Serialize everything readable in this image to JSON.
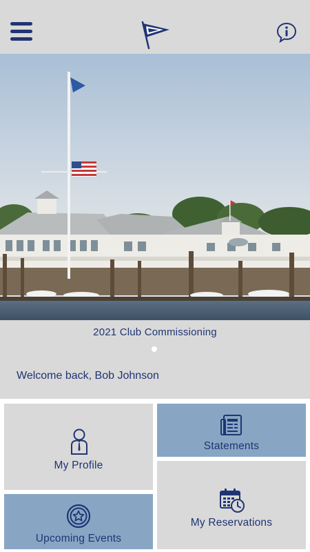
{
  "header": {
    "menu_icon": "hamburger-menu-icon",
    "logo_icon": "burgee-flag-logo",
    "info_icon": "info-speech-bubble-icon"
  },
  "hero": {
    "caption": "2021 Club Commissioning",
    "carousel": {
      "slides": 1,
      "active": 1
    }
  },
  "welcome": {
    "text": "Welcome back, Bob Johnson"
  },
  "tiles": {
    "profile": {
      "label": "My Profile",
      "icon": "person-icon"
    },
    "statements": {
      "label": "Statements",
      "icon": "statement-document-icon"
    },
    "events": {
      "label": "Upcoming Events",
      "icon": "star-badge-icon"
    },
    "reservations": {
      "label": "My Reservations",
      "icon": "calendar-clock-icon"
    }
  },
  "colors": {
    "brand_navy": "#1f3473",
    "panel_grey": "#d9d9d9",
    "tile_blue": "#88a6c4"
  }
}
